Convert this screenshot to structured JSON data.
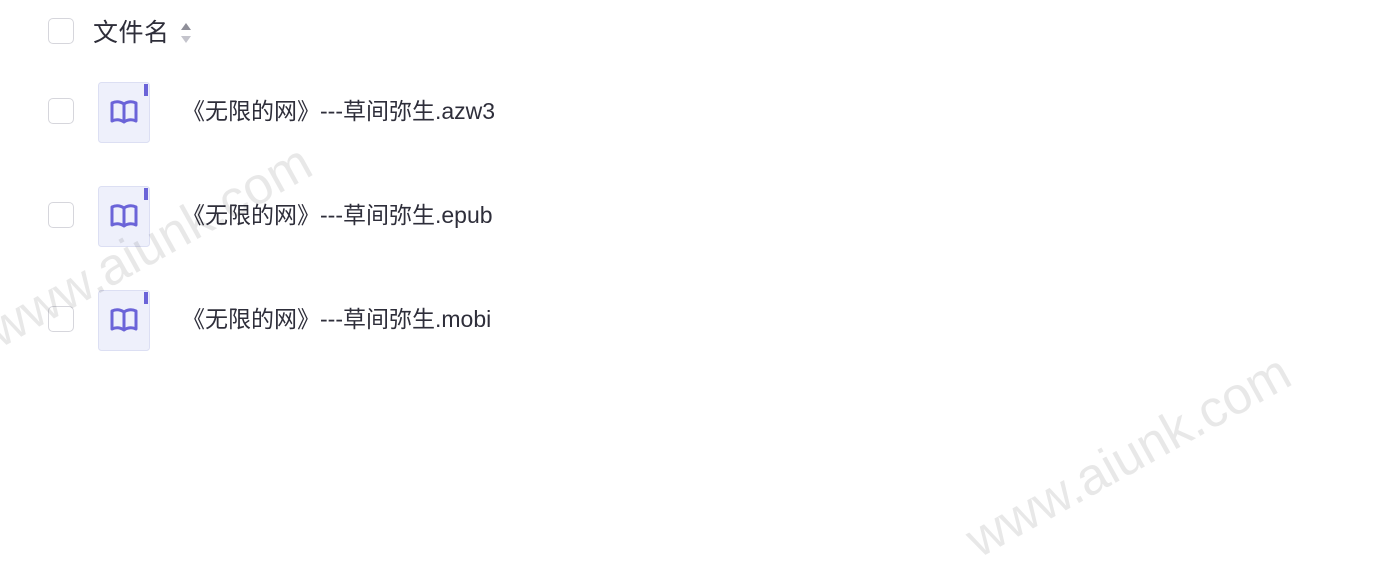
{
  "header": {
    "column_label": "文件名"
  },
  "files": [
    {
      "name": "《无限的网》---草间弥生.azw3"
    },
    {
      "name": "《无限的网》---草间弥生.epub"
    },
    {
      "name": "《无限的网》---草间弥生.mobi"
    }
  ],
  "watermark": "www.aiunk.com",
  "colors": {
    "icon_fill": "#eef0fb",
    "icon_accent": "#6b64d8",
    "checkbox_border": "#d6d6dc",
    "text": "#2e2e3a"
  },
  "icons": {
    "sort": "sort-icon",
    "file": "ebook-file-icon"
  }
}
